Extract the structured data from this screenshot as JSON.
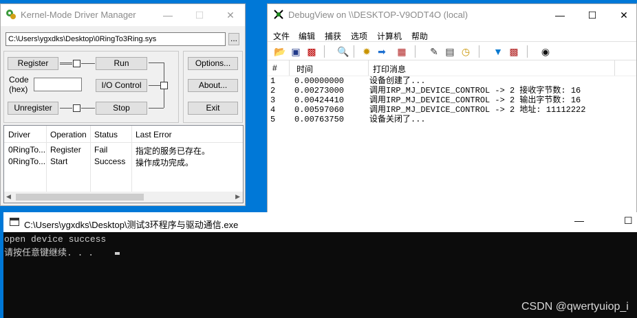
{
  "kmd": {
    "title": "Kernel-Mode Driver Manager",
    "path_value": "C:\\Users\\ygxdks\\Desktop\\0RingTo3Ring.sys",
    "browse_label": "...",
    "buttons": {
      "register": "Register",
      "run": "Run",
      "io_control": "I/O Control",
      "unregister": "Unregister",
      "stop": "Stop",
      "options": "Options...",
      "about": "About...",
      "exit": "Exit"
    },
    "code_label": "Code",
    "hex_label": "(hex)",
    "columns": [
      "Driver",
      "Operation",
      "Status",
      "Last Error"
    ],
    "rows": [
      {
        "driver": "0RingTo...",
        "operation": "Register",
        "status": "Fail",
        "error": "指定的服务已存在。"
      },
      {
        "driver": "0RingTo...",
        "operation": "Start",
        "status": "Success",
        "error": "操作成功完成。"
      }
    ]
  },
  "debugview": {
    "title": "DebugView on \\\\DESKTOP-V9ODT4O (local)",
    "menu": [
      "文件",
      "编辑",
      "捕获",
      "选项",
      "计算机",
      "帮助"
    ],
    "columns": [
      "#",
      "时间",
      "打印消息"
    ],
    "rows": [
      {
        "num": "1",
        "time": "0.00000000",
        "msg": "设备创建了..."
      },
      {
        "num": "2",
        "time": "0.00273000",
        "msg": "调用IRP_MJ_DEVICE_CONTROL -> 2 接收字节数: 16"
      },
      {
        "num": "3",
        "time": "0.00424410",
        "msg": "调用IRP_MJ_DEVICE_CONTROL -> 2 输出字节数: 16"
      },
      {
        "num": "4",
        "time": "0.00597060",
        "msg": "调用IRP_MJ_DEVICE_CONTROL -> 2 地址: 11112222"
      },
      {
        "num": "5",
        "time": "0.00763750",
        "msg": "设备关闭了..."
      }
    ]
  },
  "console": {
    "title": "C:\\Users\\ygxdks\\Desktop\\测试3环程序与驱动通信.exe",
    "lines": [
      "open device success",
      "请按任意键继续. . . "
    ]
  },
  "watermark": "CSDN @qwertyuiop_i",
  "colors": {
    "desktop": "#0078d7",
    "console_bg": "#0c0c0c",
    "console_fg": "#cccccc"
  }
}
